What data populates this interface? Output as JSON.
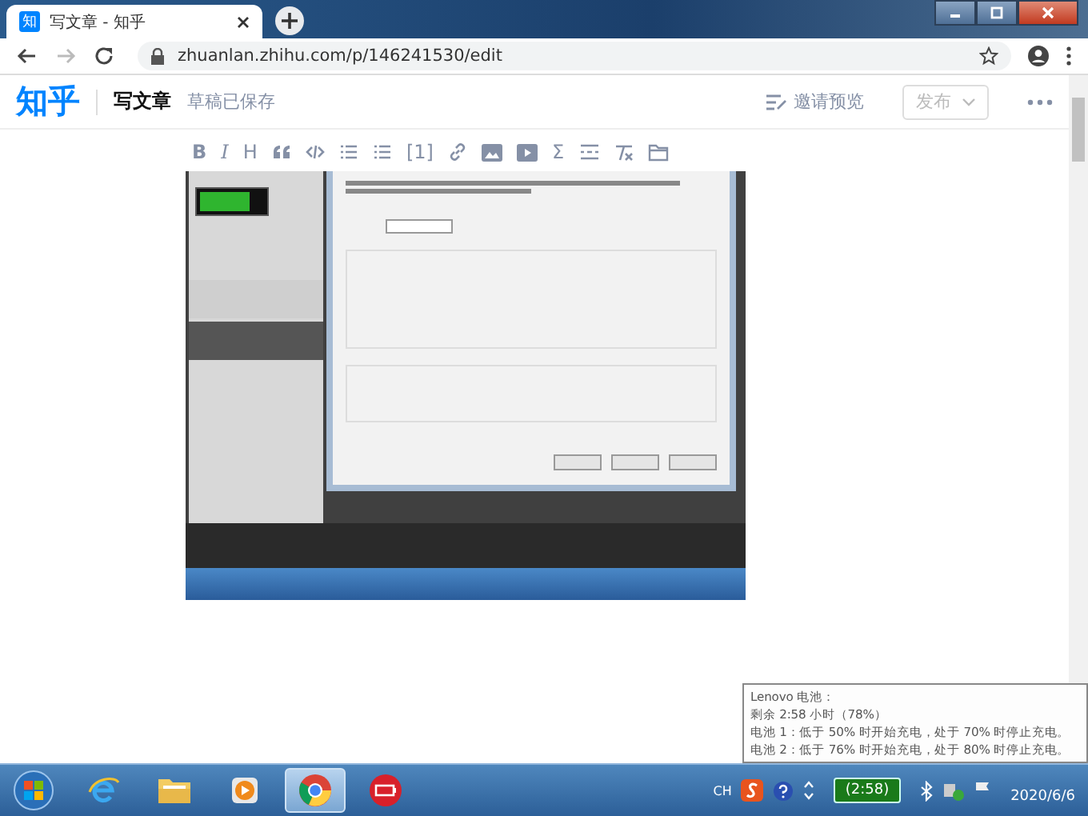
{
  "browser": {
    "tab": {
      "favicon": "知",
      "title": "写文章 - 知乎",
      "selected": true
    },
    "url": "zhuanlan.zhihu.com/p/146241530/edit"
  },
  "header": {
    "logo": "知乎",
    "page_title": "写文章",
    "save_status": "草稿已保存",
    "preview": "邀请预览",
    "publish": {
      "label": "发布",
      "disabled": true
    }
  },
  "toolbar": [
    {
      "kind": "bold",
      "label": "B"
    },
    {
      "kind": "italic",
      "label": "I"
    },
    {
      "kind": "heading",
      "label": "H"
    },
    {
      "kind": "quote"
    },
    {
      "kind": "code"
    },
    {
      "kind": "bullet"
    },
    {
      "kind": "numbered"
    },
    {
      "kind": "ref",
      "label": "[1]"
    },
    {
      "kind": "link"
    },
    {
      "kind": "image"
    },
    {
      "kind": "video"
    },
    {
      "kind": "formula",
      "label": "Σ"
    },
    {
      "kind": "divider"
    },
    {
      "kind": "clear"
    },
    {
      "kind": "attach"
    }
  ],
  "tooltip": {
    "lines": [
      "Lenovo 电池：",
      "剩余 2:58 小时（78%）",
      "电池 1：低于 50% 时开始充电，处于 70% 时停止充电。",
      "电池 2：低于 76% 时开始充电，处于 80% 时停止充电。"
    ]
  },
  "taskbar": {
    "apps": [
      {
        "kind": "ie",
        "selected": false
      },
      {
        "kind": "folder",
        "selected": false
      },
      {
        "kind": "media",
        "selected": false
      },
      {
        "kind": "chrome",
        "selected": true
      },
      {
        "kind": "battery-app",
        "selected": false
      }
    ],
    "tray": {
      "language": "CH",
      "battery": "(2:58)",
      "date": "2020/6/6"
    }
  }
}
